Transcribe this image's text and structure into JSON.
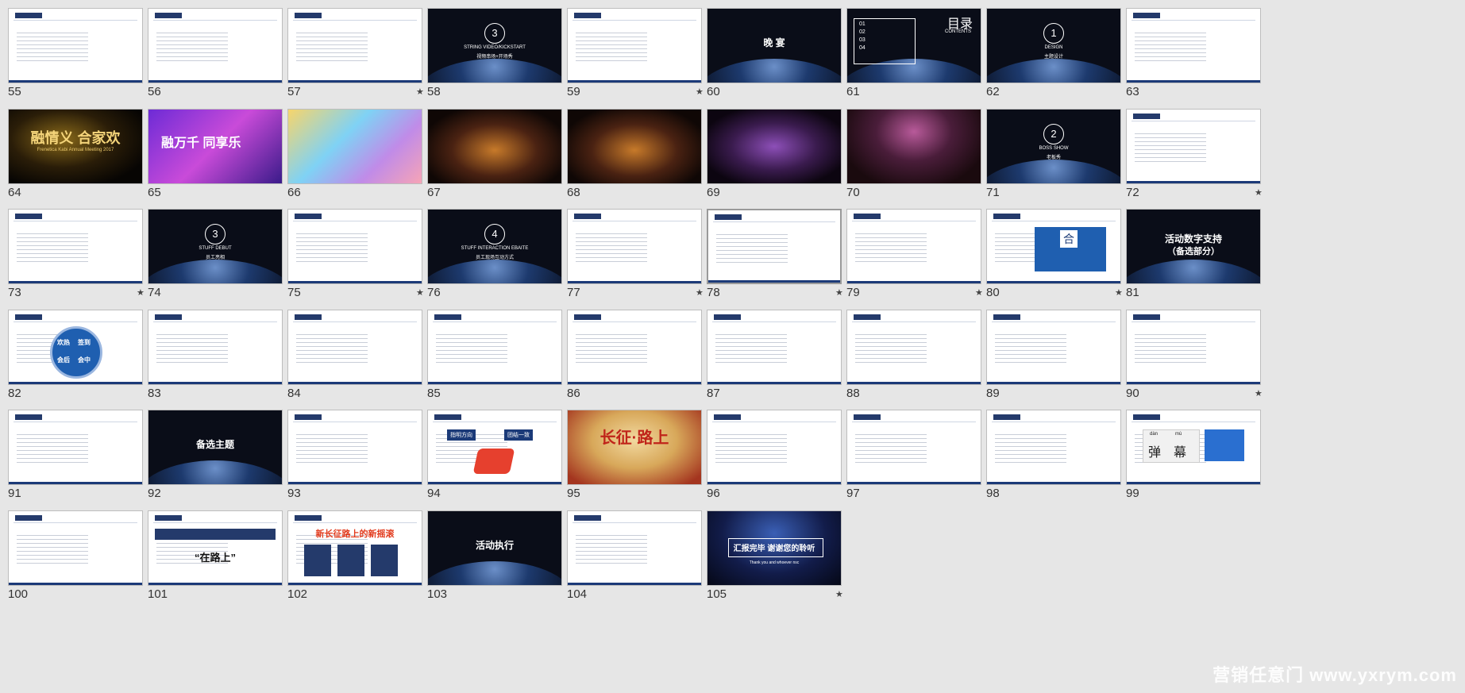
{
  "slides": [
    {
      "num": "55",
      "star": ""
    },
    {
      "num": "56",
      "star": ""
    },
    {
      "num": "57",
      "star": "★"
    },
    {
      "num": "58",
      "star": ""
    },
    {
      "num": "59",
      "star": "★"
    },
    {
      "num": "60",
      "star": ""
    },
    {
      "num": "61",
      "star": ""
    },
    {
      "num": "62",
      "star": ""
    },
    {
      "num": "63",
      "star": ""
    },
    {
      "num": "64",
      "star": ""
    },
    {
      "num": "65",
      "star": ""
    },
    {
      "num": "66",
      "star": ""
    },
    {
      "num": "67",
      "star": ""
    },
    {
      "num": "68",
      "star": ""
    },
    {
      "num": "69",
      "star": ""
    },
    {
      "num": "70",
      "star": ""
    },
    {
      "num": "71",
      "star": ""
    },
    {
      "num": "72",
      "star": "★"
    },
    {
      "num": "73",
      "star": "★"
    },
    {
      "num": "74",
      "star": ""
    },
    {
      "num": "75",
      "star": "★"
    },
    {
      "num": "76",
      "star": ""
    },
    {
      "num": "77",
      "star": "★"
    },
    {
      "num": "78",
      "star": "★"
    },
    {
      "num": "79",
      "star": "★"
    },
    {
      "num": "80",
      "star": "★"
    },
    {
      "num": "81",
      "star": ""
    },
    {
      "num": "82",
      "star": ""
    },
    {
      "num": "83",
      "star": ""
    },
    {
      "num": "84",
      "star": ""
    },
    {
      "num": "85",
      "star": ""
    },
    {
      "num": "86",
      "star": ""
    },
    {
      "num": "87",
      "star": ""
    },
    {
      "num": "88",
      "star": ""
    },
    {
      "num": "89",
      "star": ""
    },
    {
      "num": "90",
      "star": "★"
    },
    {
      "num": "91",
      "star": ""
    },
    {
      "num": "92",
      "star": ""
    },
    {
      "num": "93",
      "star": ""
    },
    {
      "num": "94",
      "star": ""
    },
    {
      "num": "95",
      "star": ""
    },
    {
      "num": "96",
      "star": ""
    },
    {
      "num": "97",
      "star": ""
    },
    {
      "num": "98",
      "star": ""
    },
    {
      "num": "99",
      "star": ""
    },
    {
      "num": "100",
      "star": ""
    },
    {
      "num": "101",
      "star": ""
    },
    {
      "num": "102",
      "star": ""
    },
    {
      "num": "103",
      "star": ""
    },
    {
      "num": "104",
      "star": ""
    },
    {
      "num": "105",
      "star": "★"
    }
  ],
  "texts": {
    "s58_title": "STRING VIDEO/KICKSTART",
    "s58_sub": "视频串场+开场秀",
    "s60": "晚 宴",
    "s61_title": "目录",
    "s61_sub": "CONTENTS",
    "s61_items": [
      "01",
      "02",
      "03",
      "04"
    ],
    "s62_num": "1",
    "s62_title": "DESIGN",
    "s62_sub": "主题设计",
    "s64_title": "融情义 合家欢",
    "s64_sub": "Frenetica Kabi Annual Meeting 2017",
    "s65_title": "融万千 同享乐",
    "s71_num": "2",
    "s71_title": "BOSS SHOW",
    "s71_sub": "老板秀",
    "s74_num": "3",
    "s74_title": "STUFF DEBUT",
    "s74_sub": "员工亮相",
    "s76_num": "4",
    "s76_title": "STUFF INTERACTION EBAITE",
    "s76_sub": "员工现场互动方式",
    "s80_tag": "合",
    "s81_line1": "活动数字支持",
    "s81_line2": "（备选部分）",
    "s82_a": "欢热",
    "s82_b": "签到",
    "s82_c": "会后",
    "s82_d": "会中",
    "s92": "备选主题",
    "s94_a": "指明方向",
    "s94_b": "团结一致",
    "s95_title": "长征·路上",
    "s99_a": "dàn",
    "s99_b": "mù",
    "s99_c": "弹",
    "s99_d": "幕",
    "s101": "“在路上”",
    "s102": "新长征路上的新摇滚",
    "s103": "活动执行",
    "s105_title": "汇报完毕 谢谢您的聆听",
    "s105_sub": "Thank you and whoever nsc",
    "watermark": "营销任意门 www.yxrym.com"
  }
}
